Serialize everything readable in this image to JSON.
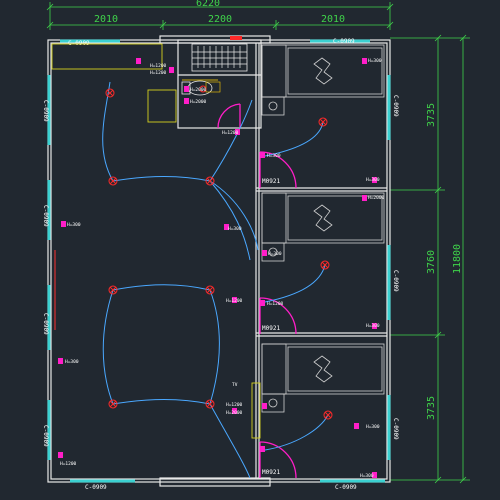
{
  "dimensions": {
    "top_total": "6220",
    "top_segments": [
      "2010",
      "2200",
      "2010"
    ],
    "right_total": "11800",
    "right_segments": [
      "3735",
      "3760",
      "3735"
    ]
  },
  "windows": {
    "top_left": "C-0909",
    "top_right": "C-0909",
    "bottom_left": "C-0909",
    "bottom_right": "C-0909",
    "left": [
      "C-0909",
      "C-0909",
      "C-0909",
      "C-0909"
    ],
    "right": [
      "C-0909",
      "C-0909",
      "C-0909"
    ]
  },
  "doors": [
    "M0921",
    "M0921",
    "M0921"
  ],
  "outlet_labels": {
    "o1": "H=1200",
    "o2": "H=1200",
    "o3": "H=2000",
    "o4": "H=2000",
    "o5": "H=300",
    "o6": "H=2000",
    "o7": "H=1200",
    "o8": "H=300",
    "o9": "H=300",
    "o10": "H=300",
    "o11": "H=300",
    "o12": "H=300",
    "o13": "H=1200",
    "o14": "H=1200",
    "o15": "H=300",
    "o16": "H=300",
    "o17": "H=1200",
    "o18": "H=2000",
    "o19": "H=300",
    "o20": "H=1200",
    "o21": "H=300"
  },
  "panel_label": "TV"
}
